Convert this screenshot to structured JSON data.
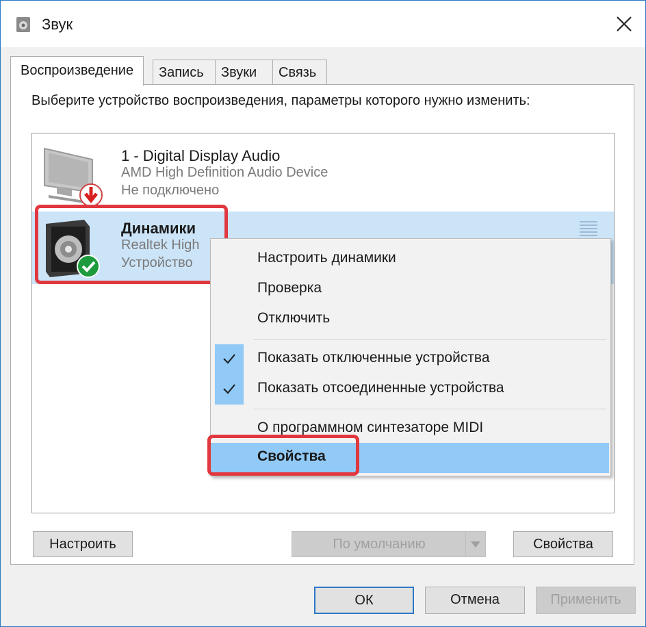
{
  "window": {
    "title": "Звук",
    "icon": "speaker-icon"
  },
  "tabs": [
    {
      "label": "Воспроизведение",
      "active": true
    },
    {
      "label": "Запись"
    },
    {
      "label": "Звуки"
    },
    {
      "label": "Связь"
    }
  ],
  "instruction": "Выберите устройство воспроизведения, параметры которого нужно изменить:",
  "devices": [
    {
      "name": "1 - Digital Display Audio",
      "driver": "AMD High Definition Audio Device",
      "status": "Не подключено",
      "icon": "monitor-icon",
      "badge": "disconnected-arrow-icon"
    },
    {
      "name": "Динамики",
      "driver": "Realtek High",
      "status": "Устройство",
      "icon": "speakers-icon",
      "badge": "default-check-icon",
      "selected": true
    }
  ],
  "context_menu": {
    "items": [
      {
        "label": "Настроить динамики"
      },
      {
        "label": "Проверка"
      },
      {
        "label": "Отключить"
      },
      {
        "label": "Показать отключенные устройства",
        "checked": true
      },
      {
        "label": "Показать отсоединенные устройства",
        "checked": true
      },
      {
        "label": "О программном синтезаторе MIDI"
      },
      {
        "label": "Свойства",
        "bold": true,
        "highlighted": true
      }
    ]
  },
  "buttons": {
    "configure": "Настроить",
    "set_default": "По умолчанию",
    "properties": "Свойства",
    "ok": "ОК",
    "cancel": "Отмена",
    "apply": "Применить"
  },
  "colors": {
    "accent": "#2b78c5",
    "selection": "#cce4f7",
    "menu_hover": "#91c9f7",
    "highlight_box": "#e0383e"
  }
}
